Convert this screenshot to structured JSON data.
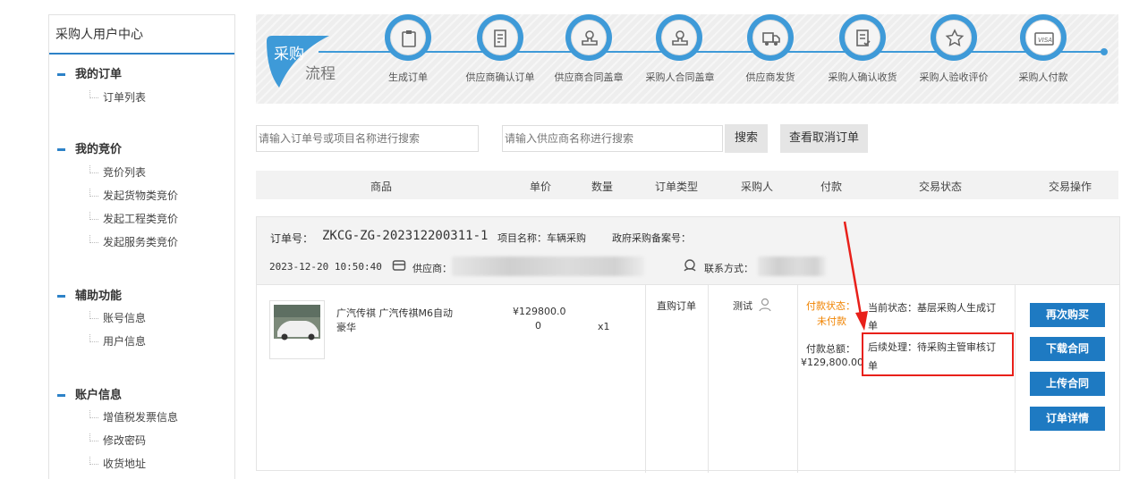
{
  "sidebar": {
    "title": "采购人用户中心",
    "groups": [
      {
        "label": "我的订单",
        "items": [
          "订单列表"
        ]
      },
      {
        "label": "我的竞价",
        "items": [
          "竞价列表",
          "发起货物类竞价",
          "发起工程类竞价",
          "发起服务类竞价"
        ]
      },
      {
        "label": "辅助功能",
        "items": [
          "账号信息",
          "用户信息"
        ]
      },
      {
        "label": "账户信息",
        "items": [
          "增值税发票信息",
          "修改密码",
          "收货地址"
        ]
      }
    ]
  },
  "flow": {
    "badge_line1": "采购",
    "badge_line2": "流程",
    "accent_color": "#3e9ad8",
    "steps": [
      {
        "label": "生成订单",
        "icon": "clipboard-icon"
      },
      {
        "label": "供应商确认订单",
        "icon": "document-edit-icon"
      },
      {
        "label": "供应商合同盖章",
        "icon": "stamp-icon"
      },
      {
        "label": "采购人合同盖章",
        "icon": "stamp-icon"
      },
      {
        "label": "供应商发货",
        "icon": "delivery-truck-icon"
      },
      {
        "label": "采购人确认收货",
        "icon": "receipt-check-icon"
      },
      {
        "label": "采购人验收评价",
        "icon": "star-icon"
      },
      {
        "label": "采购人付款",
        "icon": "visa-card-icon"
      }
    ]
  },
  "search": {
    "order_placeholder": "请输入订单号或项目名称进行搜索",
    "supplier_placeholder": "请输入供应商名称进行搜索",
    "search_label": "搜索",
    "cancelled_label": "查看取消订单"
  },
  "table_headers": [
    "商品",
    "单价",
    "数量",
    "订单类型",
    "采购人",
    "付款",
    "交易状态",
    "交易操作"
  ],
  "order": {
    "order_no_label": "订单号：",
    "order_no": "ZKCG-ZG-202312200311-1",
    "project_label": "项目名称：车辆采购",
    "record_label": "政府采购备案号：",
    "datetime": "2023-12-20 10:50:40",
    "supplier_label": "供应商：",
    "contact_label": "联系方式：",
    "product_name_line1": "广汽传祺 广汽传祺M6自动",
    "product_name_line2": "豪华",
    "unit_price_line1": "¥129800.0",
    "unit_price_line2": "0",
    "quantity": "x1",
    "order_type": "直购订单",
    "buyer": "测试",
    "pay_status_label": "付款状态：",
    "pay_status_value": "未付款",
    "pay_total_label": "付款总额：",
    "pay_total_value": "¥129,800.00",
    "current_status_line1": "当前状态：基层采购人生成订",
    "current_status_line2": "单",
    "next_step_line1": "后续处理：待采购主管审核订",
    "next_step_line2": "单",
    "actions": [
      "再次购买",
      "下载合同",
      "上传合同",
      "订单详情"
    ]
  },
  "annotation_color": "#e8201a"
}
